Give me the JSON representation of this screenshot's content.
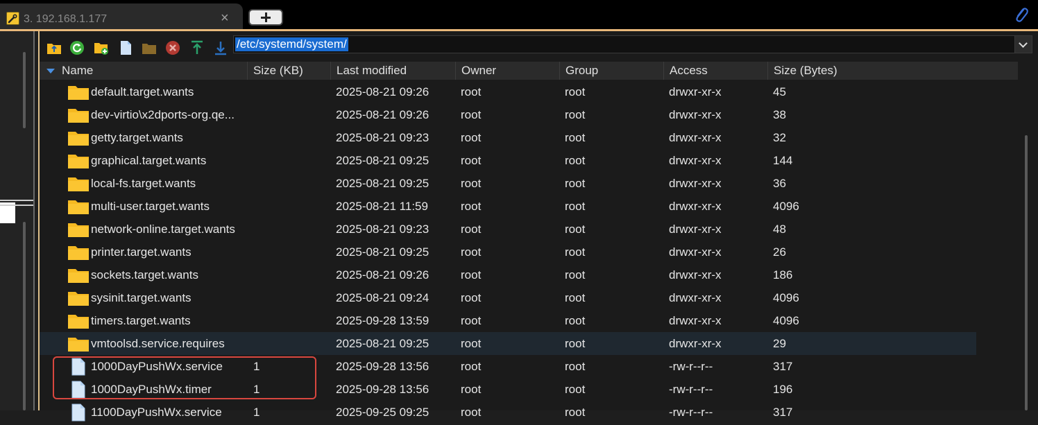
{
  "tab": {
    "title": "3. 192.168.1.177",
    "close": "×"
  },
  "path": {
    "value": "/etc/systemd/system/"
  },
  "columns": [
    "Name",
    "Size (KB)",
    "Last modified",
    "Owner",
    "Group",
    "Access",
    "Size (Bytes)"
  ],
  "files": [
    {
      "type": "folder",
      "name": "default.target.wants",
      "size_kb": "",
      "modified": "2025-08-21 09:26",
      "owner": "root",
      "group": "root",
      "access": "drwxr-xr-x",
      "bytes": "45"
    },
    {
      "type": "folder",
      "name": "dev-virtio\\x2dports-org.qe...",
      "size_kb": "",
      "modified": "2025-08-21 09:26",
      "owner": "root",
      "group": "root",
      "access": "drwxr-xr-x",
      "bytes": "38"
    },
    {
      "type": "folder",
      "name": "getty.target.wants",
      "size_kb": "",
      "modified": "2025-08-21 09:23",
      "owner": "root",
      "group": "root",
      "access": "drwxr-xr-x",
      "bytes": "32"
    },
    {
      "type": "folder",
      "name": "graphical.target.wants",
      "size_kb": "",
      "modified": "2025-08-21 09:25",
      "owner": "root",
      "group": "root",
      "access": "drwxr-xr-x",
      "bytes": "144"
    },
    {
      "type": "folder",
      "name": "local-fs.target.wants",
      "size_kb": "",
      "modified": "2025-08-21 09:25",
      "owner": "root",
      "group": "root",
      "access": "drwxr-xr-x",
      "bytes": "36"
    },
    {
      "type": "folder",
      "name": "multi-user.target.wants",
      "size_kb": "",
      "modified": "2025-08-21 11:59",
      "owner": "root",
      "group": "root",
      "access": "drwxr-xr-x",
      "bytes": "4096"
    },
    {
      "type": "folder",
      "name": "network-online.target.wants",
      "size_kb": "",
      "modified": "2025-08-21 09:23",
      "owner": "root",
      "group": "root",
      "access": "drwxr-xr-x",
      "bytes": "48"
    },
    {
      "type": "folder",
      "name": "printer.target.wants",
      "size_kb": "",
      "modified": "2025-08-21 09:25",
      "owner": "root",
      "group": "root",
      "access": "drwxr-xr-x",
      "bytes": "26"
    },
    {
      "type": "folder",
      "name": "sockets.target.wants",
      "size_kb": "",
      "modified": "2025-08-21 09:26",
      "owner": "root",
      "group": "root",
      "access": "drwxr-xr-x",
      "bytes": "186"
    },
    {
      "type": "folder",
      "name": "sysinit.target.wants",
      "size_kb": "",
      "modified": "2025-08-21 09:24",
      "owner": "root",
      "group": "root",
      "access": "drwxr-xr-x",
      "bytes": "4096"
    },
    {
      "type": "folder",
      "name": "timers.target.wants",
      "size_kb": "",
      "modified": "2025-09-28 13:59",
      "owner": "root",
      "group": "root",
      "access": "drwxr-xr-x",
      "bytes": "4096"
    },
    {
      "type": "folder",
      "name": "vmtoolsd.service.requires",
      "size_kb": "",
      "modified": "2025-08-21 09:25",
      "owner": "root",
      "group": "root",
      "access": "drwxr-xr-x",
      "bytes": "29",
      "selected": true
    },
    {
      "type": "file",
      "name": "1000DayPushWx.service",
      "size_kb": "1",
      "modified": "2025-09-28 13:56",
      "owner": "root",
      "group": "root",
      "access": "-rw-r--r--",
      "bytes": "317"
    },
    {
      "type": "file",
      "name": "1000DayPushWx.timer",
      "size_kb": "1",
      "modified": "2025-09-28 13:56",
      "owner": "root",
      "group": "root",
      "access": "-rw-r--r--",
      "bytes": "196"
    },
    {
      "type": "file",
      "name": "1100DayPushWx.service",
      "size_kb": "1",
      "modified": "2025-09-25 09:25",
      "owner": "root",
      "group": "root",
      "access": "-rw-r--r--",
      "bytes": "317"
    }
  ],
  "colors": {
    "accent": "#1a6cd1",
    "folder": "#f5b921",
    "highlight": "#d9473f",
    "selected_row": "#1f2830"
  },
  "icons": [
    "wrench-icon",
    "paperclip-icon",
    "folder-up-icon",
    "refresh-icon",
    "new-folder-icon",
    "new-file-icon",
    "open-folder-icon",
    "delete-icon",
    "upload-icon",
    "download-icon"
  ]
}
